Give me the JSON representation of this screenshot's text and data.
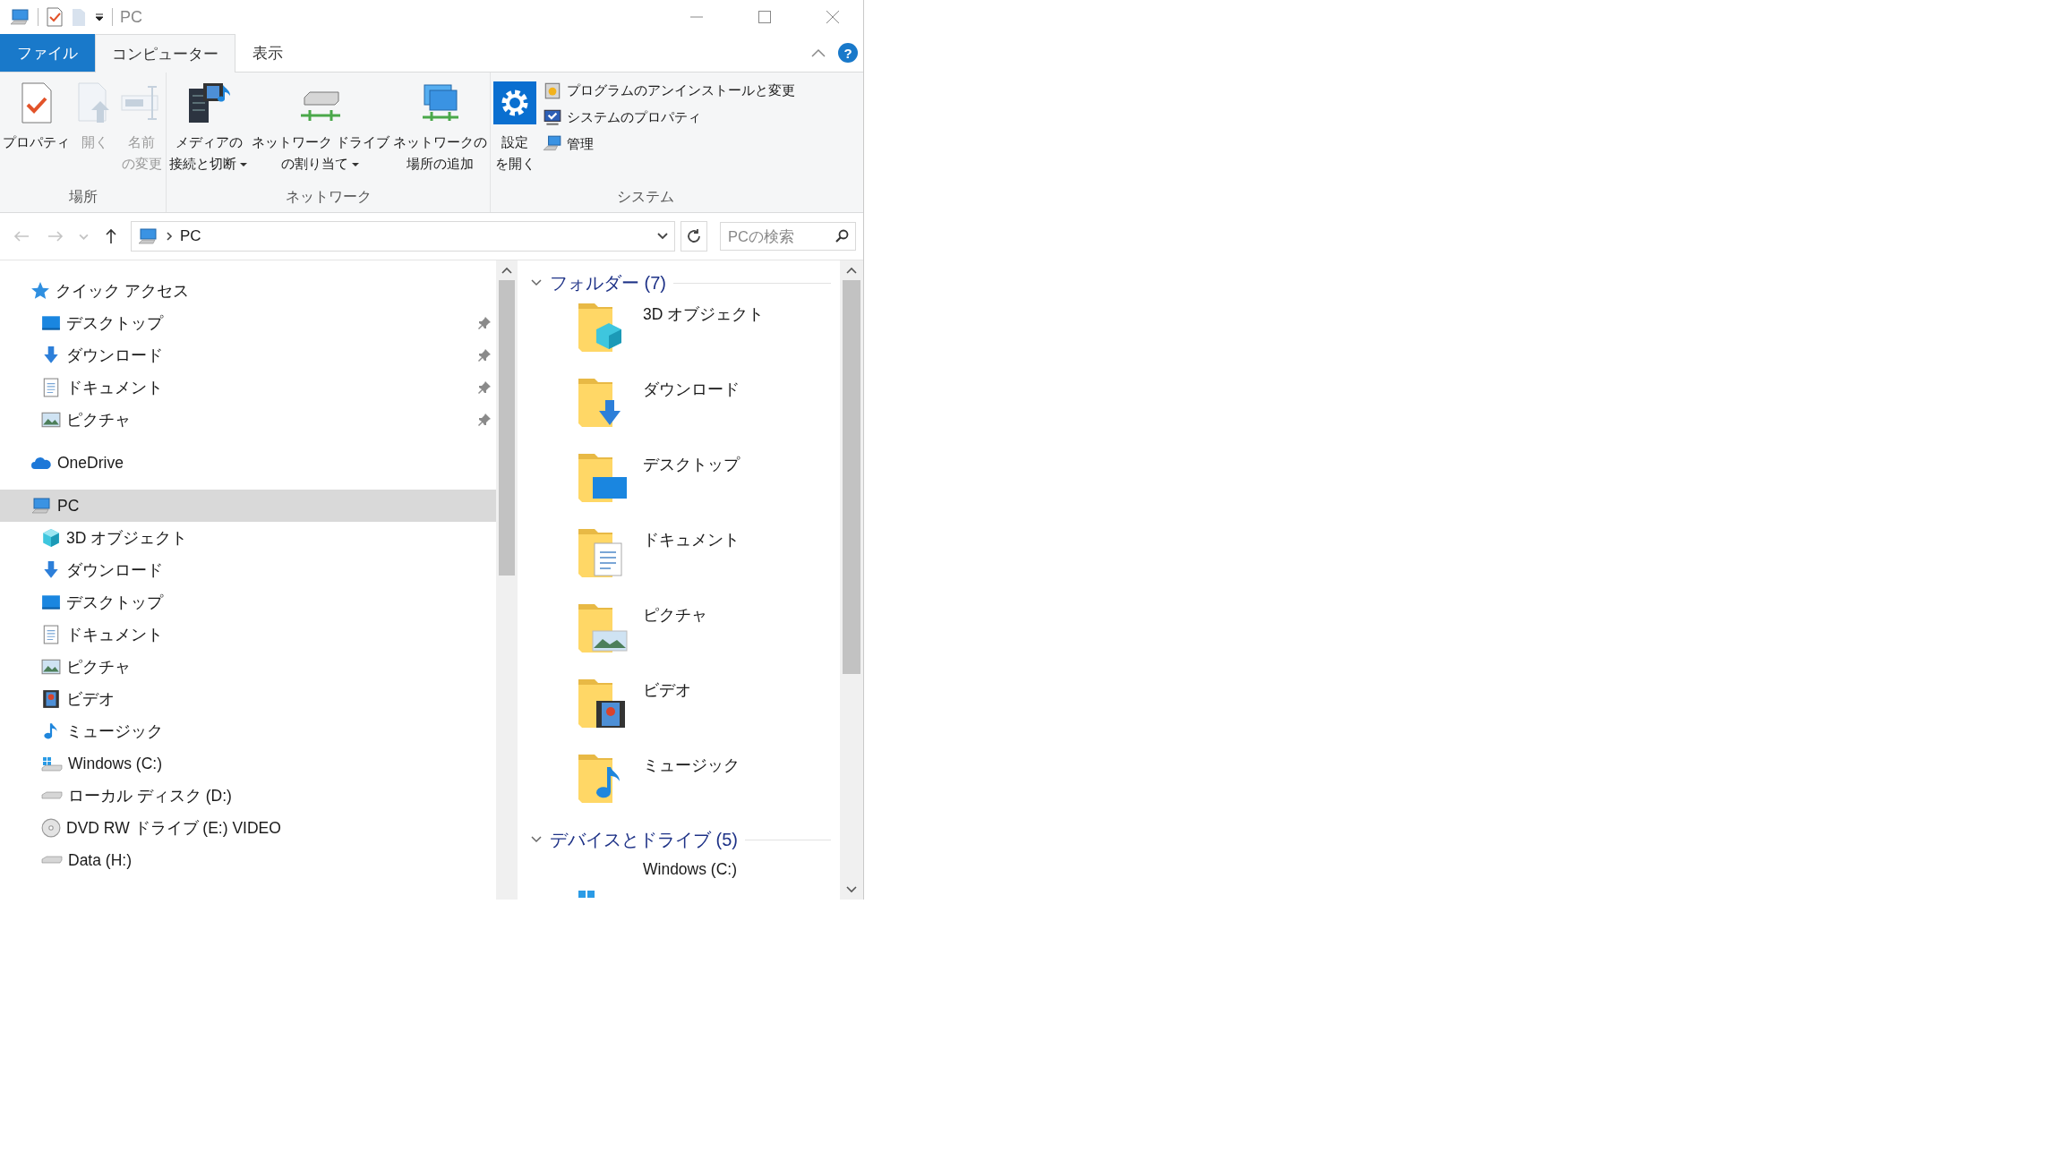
{
  "window": {
    "title": "PC"
  },
  "ribbon_tabs": [
    {
      "label": "ファイル",
      "kind": "file",
      "selected": false
    },
    {
      "label": "コンピューター",
      "kind": "tab",
      "selected": true
    },
    {
      "label": "表示",
      "kind": "tab",
      "selected": false
    }
  ],
  "help_label": "?",
  "ribbon_groups": [
    {
      "label": "場所",
      "items": [
        {
          "kind": "large",
          "lines": [
            "プロパティ"
          ],
          "disabled": false,
          "dropdown": false
        },
        {
          "kind": "large",
          "lines": [
            "開く"
          ],
          "disabled": true,
          "dropdown": false
        },
        {
          "kind": "large",
          "lines": [
            "名前",
            "の変更"
          ],
          "disabled": true,
          "dropdown": false
        }
      ]
    },
    {
      "label": "ネットワーク",
      "items": [
        {
          "kind": "large",
          "lines": [
            "メディアの",
            "接続と切断"
          ],
          "disabled": false,
          "dropdown": true
        },
        {
          "kind": "large",
          "lines": [
            "ネットワーク ドライブ",
            "の割り当て"
          ],
          "disabled": false,
          "dropdown": true
        },
        {
          "kind": "large",
          "lines": [
            "ネットワークの",
            "場所の追加"
          ],
          "disabled": false,
          "dropdown": false
        }
      ]
    },
    {
      "label": "システム",
      "items": [
        {
          "kind": "large",
          "lines": [
            "設定",
            "を開く"
          ],
          "disabled": false,
          "dropdown": false
        },
        {
          "kind": "small",
          "lines": [
            "プログラムのアンインストールと変更"
          ],
          "disabled": false
        },
        {
          "kind": "small",
          "lines": [
            "システムのプロパティ"
          ],
          "disabled": false
        },
        {
          "kind": "small",
          "lines": [
            "管理"
          ],
          "disabled": false
        }
      ]
    }
  ],
  "nav_buttons": [
    {
      "kind": "back",
      "disabled": true
    },
    {
      "kind": "forward",
      "disabled": true
    },
    {
      "kind": "recent",
      "disabled": true
    },
    {
      "kind": "up",
      "disabled": false
    }
  ],
  "address": {
    "path": "PC"
  },
  "search": {
    "placeholder": "PCの検索"
  },
  "navigation": [
    {
      "label": "クイック アクセス",
      "selected": false,
      "pinned": false,
      "children": [
        {
          "label": "デスクトップ",
          "selected": false,
          "pinned": true
        },
        {
          "label": "ダウンロード",
          "selected": false,
          "pinned": true
        },
        {
          "label": "ドキュメント",
          "selected": false,
          "pinned": true
        },
        {
          "label": "ピクチャ",
          "selected": false,
          "pinned": true
        }
      ]
    },
    {
      "label": "OneDrive",
      "selected": false,
      "pinned": false
    },
    {
      "label": "PC",
      "selected": true,
      "pinned": false,
      "children": [
        {
          "label": "3D オブジェクト",
          "selected": false,
          "pinned": false
        },
        {
          "label": "ダウンロード",
          "selected": false,
          "pinned": false
        },
        {
          "label": "デスクトップ",
          "selected": false,
          "pinned": false
        },
        {
          "label": "ドキュメント",
          "selected": false,
          "pinned": false
        },
        {
          "label": "ピクチャ",
          "selected": false,
          "pinned": false
        },
        {
          "label": "ビデオ",
          "selected": false,
          "pinned": false
        },
        {
          "label": "ミュージック",
          "selected": false,
          "pinned": false
        },
        {
          "label": "Windows (C:)",
          "selected": false,
          "pinned": false
        },
        {
          "label": "ローカル ディスク (D:)",
          "selected": false,
          "pinned": false
        },
        {
          "label": "DVD RW ドライブ (E:) VIDEO",
          "selected": false,
          "pinned": false
        },
        {
          "label": "Data (H:)",
          "selected": false,
          "pinned": false
        }
      ]
    }
  ],
  "content_groups": [
    {
      "title": "フォルダー (7)",
      "expanded": true,
      "items": [
        "3D オブジェクト",
        "ダウンロード",
        "デスクトップ",
        "ドキュメント",
        "ピクチャ",
        "ビデオ",
        "ミュージック"
      ]
    },
    {
      "title": "デバイスとドライブ (5)",
      "expanded": true,
      "items": [
        "Windows (C:)"
      ]
    }
  ]
}
